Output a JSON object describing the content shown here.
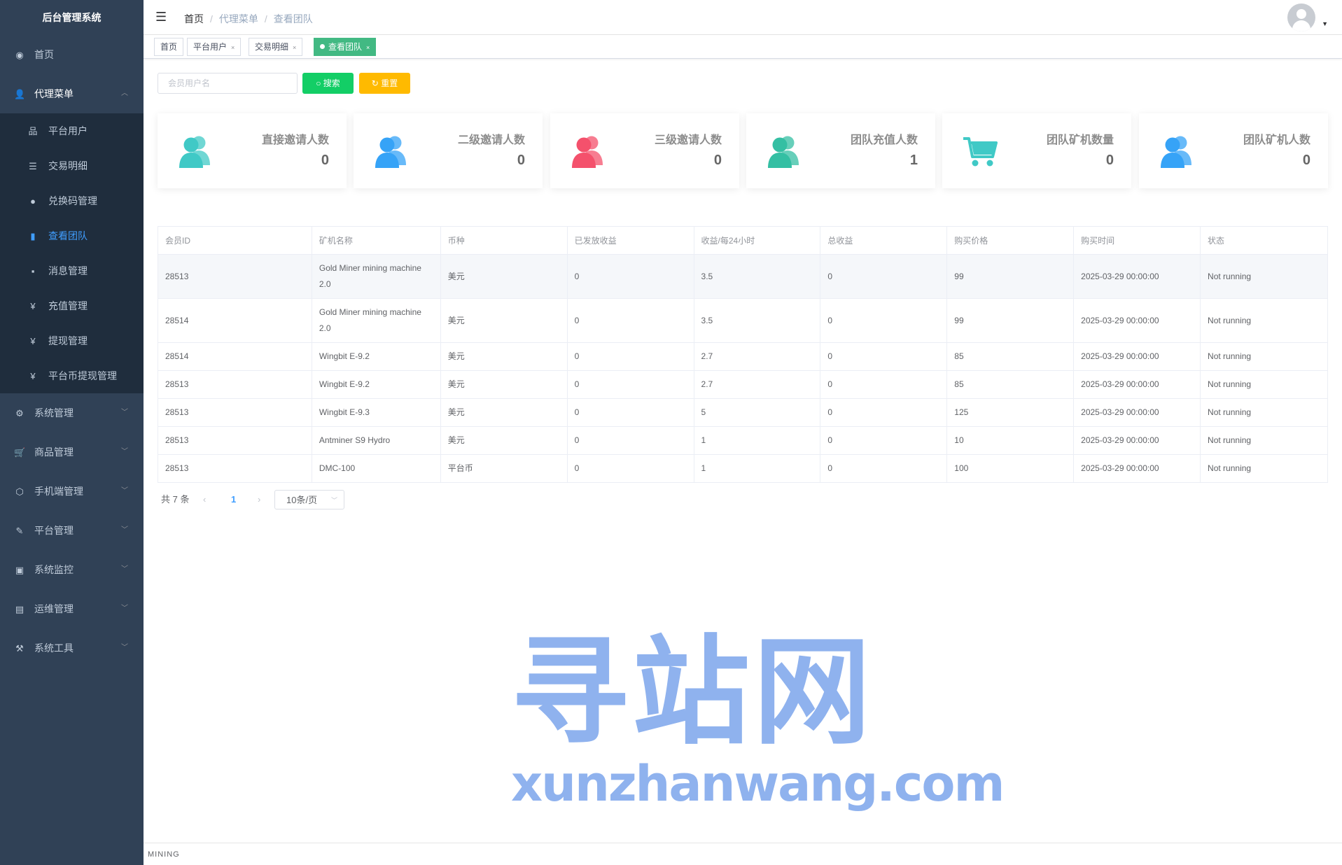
{
  "app": {
    "title": "后台管理系统"
  },
  "sidebar": {
    "items": [
      {
        "label": "首页",
        "icon": "dashboard-icon",
        "glyph": "◉"
      },
      {
        "label": "代理菜单",
        "icon": "user-icon",
        "glyph": "👤",
        "chevron": "︿"
      },
      {
        "label": "系统管理",
        "icon": "gear-icon",
        "glyph": "⚙",
        "chevron": "﹀"
      },
      {
        "label": "商品管理",
        "icon": "cart-icon",
        "glyph": "🛒",
        "chevron": "﹀"
      },
      {
        "label": "手机端管理",
        "icon": "cube-icon",
        "glyph": "⬡",
        "chevron": "﹀"
      },
      {
        "label": "平台管理",
        "icon": "tools-icon",
        "glyph": "✎",
        "chevron": "﹀"
      },
      {
        "label": "系统监控",
        "icon": "monitor-icon",
        "glyph": "▣",
        "chevron": "﹀"
      },
      {
        "label": "运维管理",
        "icon": "server-icon",
        "glyph": "▤",
        "chevron": "﹀"
      },
      {
        "label": "系统工具",
        "icon": "toolkit-icon",
        "glyph": "⚒",
        "chevron": "﹀"
      }
    ],
    "submenu": [
      {
        "label": "平台用户",
        "icon": "tree-icon",
        "glyph": "品"
      },
      {
        "label": "交易明细",
        "icon": "list-icon",
        "glyph": "☰"
      },
      {
        "label": "兑换码管理",
        "icon": "coin-icon",
        "glyph": "●"
      },
      {
        "label": "查看团队",
        "icon": "chart-icon",
        "glyph": "▮"
      },
      {
        "label": "消息管理",
        "icon": "message-icon",
        "glyph": "▪"
      },
      {
        "label": "充值管理",
        "icon": "yen-icon",
        "glyph": "¥"
      },
      {
        "label": "提现管理",
        "icon": "yen-icon",
        "glyph": "¥"
      },
      {
        "label": "平台币提现管理",
        "icon": "yen-icon",
        "glyph": "¥"
      }
    ]
  },
  "navbar": {
    "hamburger_glyph": "☰",
    "breadcrumb": [
      "首页",
      "代理菜单",
      "查看团队"
    ],
    "separator": "/",
    "caret": "▼"
  },
  "tags": [
    {
      "label": "首页"
    },
    {
      "label": "平台用户",
      "close": "×"
    },
    {
      "label": "交易明细",
      "close": "×"
    },
    {
      "label": "查看团队",
      "close": "×"
    }
  ],
  "search": {
    "placeholder": "会员用户名",
    "search_label": "搜索",
    "search_glyph": "○",
    "reset_label": "重置",
    "reset_glyph": "↻"
  },
  "stats": [
    {
      "label": "直接邀请人数",
      "value": "0",
      "icon": "users-icon",
      "color": "#40c9c6"
    },
    {
      "label": "二级邀请人数",
      "value": "0",
      "icon": "users-icon",
      "color": "#36a3f7"
    },
    {
      "label": "三级邀请人数",
      "value": "0",
      "icon": "users-icon",
      "color": "#f4516c"
    },
    {
      "label": "团队充值人数",
      "value": "1",
      "icon": "users-icon",
      "color": "#34bfa3"
    },
    {
      "label": "团队矿机数量",
      "value": "0",
      "icon": "cart-icon",
      "color": "#40c9c6"
    },
    {
      "label": "团队矿机人数",
      "value": "0",
      "icon": "users-icon",
      "color": "#36a3f7"
    }
  ],
  "table": {
    "columns": [
      "会员ID",
      "矿机名称",
      "币种",
      "已发放收益",
      "收益/每24小时",
      "总收益",
      "购买价格",
      "购买时间",
      "状态"
    ],
    "rows": [
      [
        "28513",
        "Gold Miner mining machine 2.0",
        "美元",
        "0",
        "3.5",
        "0",
        "99",
        "2025-03-29 00:00:00",
        "Not running"
      ],
      [
        "28514",
        "Gold Miner mining machine 2.0",
        "美元",
        "0",
        "3.5",
        "0",
        "99",
        "2025-03-29 00:00:00",
        "Not running"
      ],
      [
        "28514",
        "Wingbit E-9.2",
        "美元",
        "0",
        "2.7",
        "0",
        "85",
        "2025-03-29 00:00:00",
        "Not running"
      ],
      [
        "28513",
        "Wingbit E-9.2",
        "美元",
        "0",
        "2.7",
        "0",
        "85",
        "2025-03-29 00:00:00",
        "Not running"
      ],
      [
        "28513",
        "Wingbit E-9.3",
        "美元",
        "0",
        "5",
        "0",
        "125",
        "2025-03-29 00:00:00",
        "Not running"
      ],
      [
        "28513",
        "Antminer S9 Hydro",
        "美元",
        "0",
        "1",
        "0",
        "10",
        "2025-03-29 00:00:00",
        "Not running"
      ],
      [
        "28513",
        "DMC-100",
        "平台币",
        "0",
        "1",
        "0",
        "100",
        "2025-03-29 00:00:00",
        "Not running"
      ]
    ]
  },
  "pagination": {
    "total": "共 7 条",
    "prev": "‹",
    "page": "1",
    "next": "›",
    "page_size": "10条/页",
    "chevron": "﹀"
  },
  "watermark": {
    "cn": "寻站网",
    "en": "xunzhanwang.com"
  },
  "footer": {
    "text": "MINING"
  }
}
